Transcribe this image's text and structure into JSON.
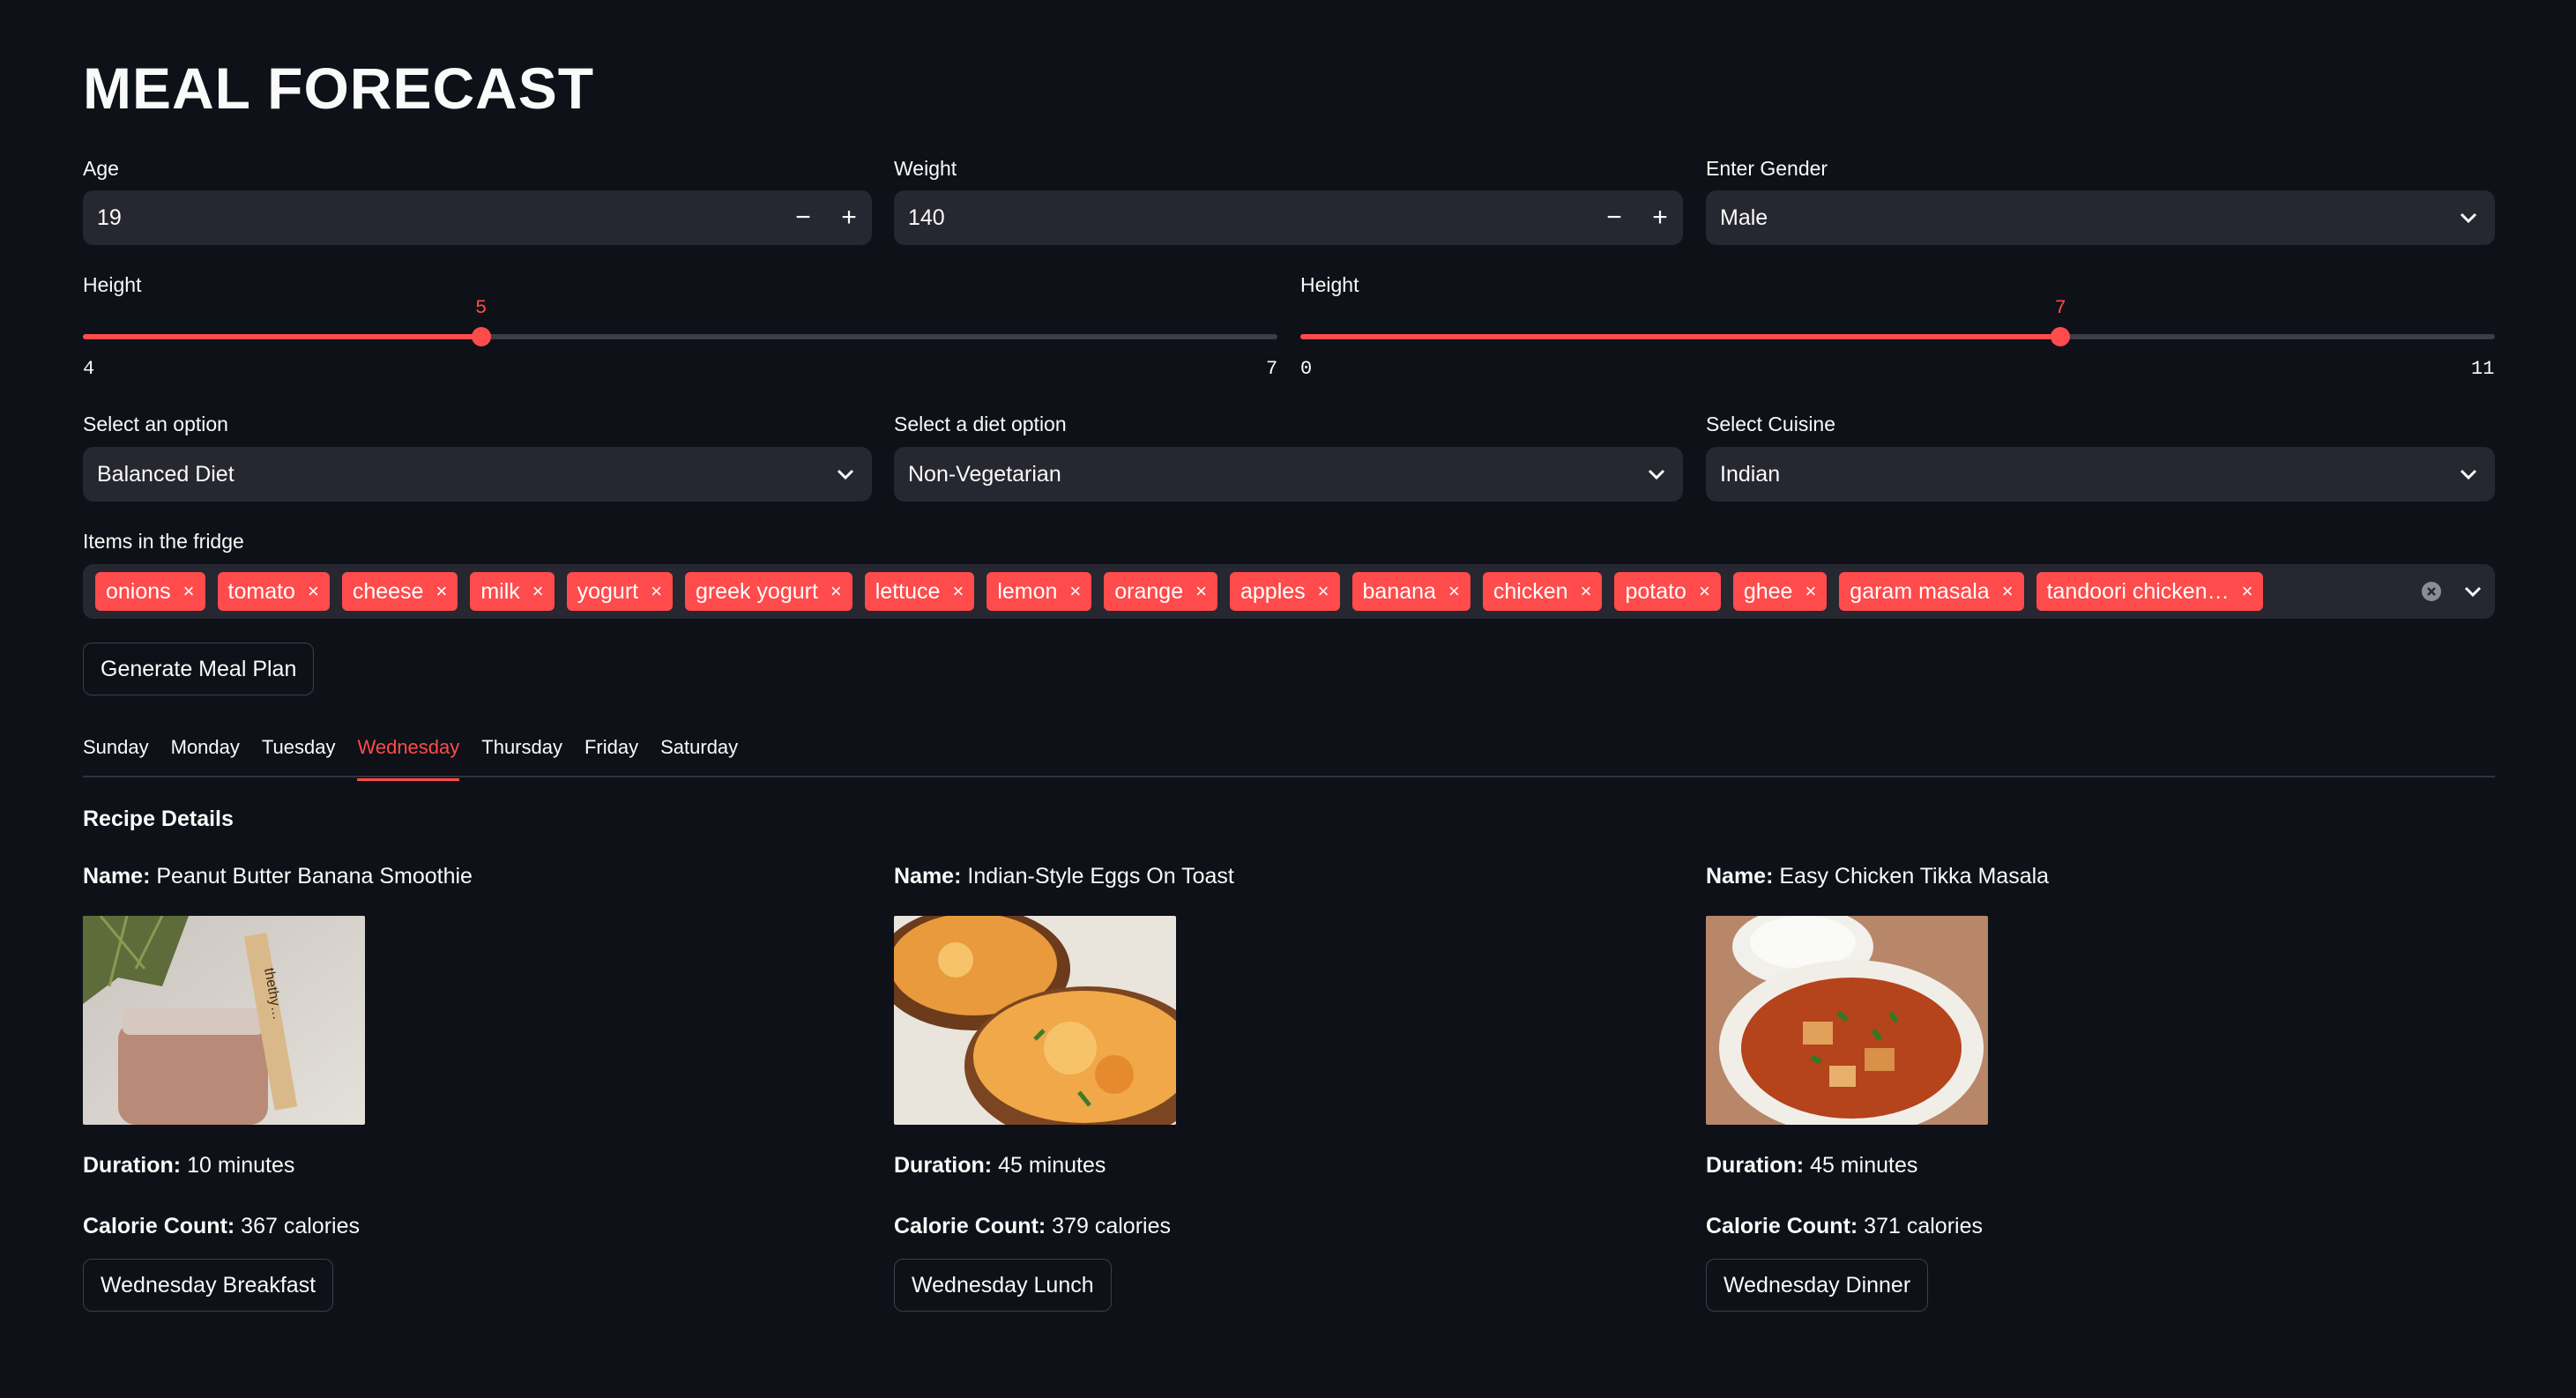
{
  "app": {
    "title": "MEAL FORECAST"
  },
  "age": {
    "label": "Age",
    "value": "19",
    "minus": "−",
    "plus": "+"
  },
  "weight": {
    "label": "Weight",
    "value": "140",
    "minus": "−",
    "plus": "+"
  },
  "gender": {
    "label": "Enter Gender",
    "value": "Male"
  },
  "height_feet": {
    "label": "Height",
    "value": 5,
    "min": 4,
    "max": 7,
    "value_text": "5",
    "min_text": "4",
    "max_text": "7"
  },
  "height_inches": {
    "label": "Height",
    "value": 7,
    "min": 0,
    "max": 11,
    "value_text": "7",
    "min_text": "0",
    "max_text": "11"
  },
  "option": {
    "label": "Select an option",
    "value": "Balanced Diet"
  },
  "diet": {
    "label": "Select a diet option",
    "value": "Non-Vegetarian"
  },
  "cuisine": {
    "label": "Select Cuisine",
    "value": "Indian"
  },
  "fridge": {
    "label": "Items in the fridge",
    "items": [
      "onions",
      "tomato",
      "cheese",
      "milk",
      "yogurt",
      "greek yogurt",
      "lettuce",
      "lemon",
      "orange",
      "apples",
      "banana",
      "chicken",
      "potato",
      "ghee",
      "garam masala",
      "tandoori chicken…"
    ],
    "remove_glyph": "×"
  },
  "generate_button": "Generate Meal Plan",
  "tabs": [
    "Sunday",
    "Monday",
    "Tuesday",
    "Wednesday",
    "Thursday",
    "Friday",
    "Saturday"
  ],
  "active_tab": "Wednesday",
  "recipe_section_title": "Recipe Details",
  "labels": {
    "name": "Name:",
    "duration": "Duration:",
    "calories": "Calorie Count:"
  },
  "recipes": [
    {
      "name": "Peanut Butter Banana Smoothie",
      "duration": "10 minutes",
      "calories": "367 calories",
      "button": "Wednesday Breakfast",
      "image_text": "thethy…"
    },
    {
      "name": "Indian-Style Eggs On Toast",
      "duration": "45 minutes",
      "calories": "379 calories",
      "button": "Wednesday Lunch"
    },
    {
      "name": "Easy Chicken Tikka Masala",
      "duration": "45 minutes",
      "calories": "371 calories",
      "button": "Wednesday Dinner"
    }
  ],
  "colors": {
    "background": "#0e1117",
    "input": "#262730",
    "accent": "#ff4b4b",
    "text": "#fafafa"
  }
}
